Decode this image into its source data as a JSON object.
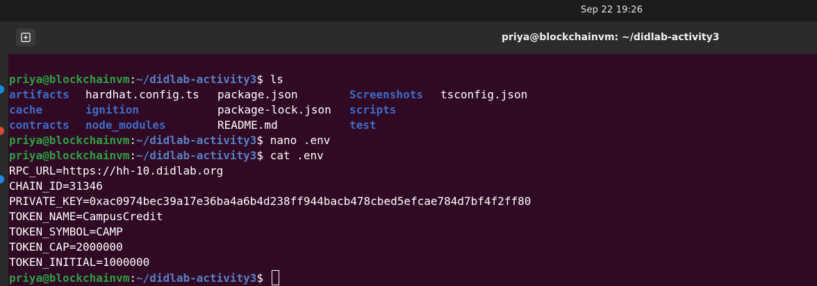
{
  "system": {
    "clock": "Sep 22  19:26"
  },
  "window": {
    "title": "priya@blockchainvm: ~/didlab-activity3"
  },
  "prompt": {
    "user_host": "priya@blockchainvm",
    "colon": ":",
    "path": "~/didlab-activity3",
    "symbol": "$"
  },
  "commands": [
    "ls",
    "nano .env",
    "cat .env"
  ],
  "ls_rows": [
    [
      {
        "name": "artifacts",
        "type": "dir"
      },
      {
        "name": "hardhat.config.ts",
        "type": "file"
      },
      {
        "name": "package.json",
        "type": "file"
      },
      {
        "name": "Screenshots",
        "type": "dir"
      },
      {
        "name": "tsconfig.json",
        "type": "file"
      }
    ],
    [
      {
        "name": "cache",
        "type": "dir"
      },
      {
        "name": "ignition",
        "type": "dir"
      },
      {
        "name": "package-lock.json",
        "type": "file"
      },
      {
        "name": "scripts",
        "type": "dir"
      }
    ],
    [
      {
        "name": "contracts",
        "type": "dir"
      },
      {
        "name": "node_modules",
        "type": "dir"
      },
      {
        "name": "README.md",
        "type": "file"
      },
      {
        "name": "test",
        "type": "dir"
      }
    ]
  ],
  "env_output": [
    "RPC_URL=https://hh-10.didlab.org",
    "CHAIN_ID=31346",
    "PRIVATE_KEY=0xac0974bec39a17e36ba4a6b4d238ff944bacb478cbed5efcae784d7bf4f2ff80",
    "TOKEN_NAME=CampusCredit",
    "TOKEN_SYMBOL=CAMP",
    "TOKEN_CAP=2000000",
    "TOKEN_INITIAL=1000000"
  ],
  "colors": {
    "terminal_bg": "#300a24",
    "user_host": "#2ea043",
    "path": "#5a7fc4",
    "directory": "#3f6cc8"
  }
}
